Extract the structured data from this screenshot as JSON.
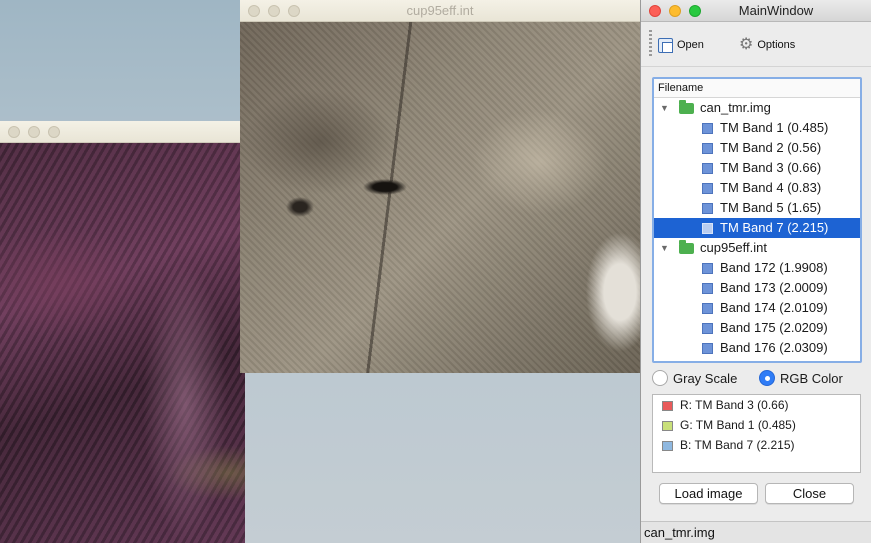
{
  "windows": {
    "left_image": {
      "title": ""
    },
    "mid_image": {
      "title": "cup95eff.int"
    },
    "main": {
      "title": "MainWindow",
      "toolbar": {
        "open_label": "Open",
        "options_label": "Options"
      },
      "tree": {
        "header": "Filename",
        "files": [
          {
            "name": "can_tmr.img",
            "bands": [
              "TM Band 1 (0.485)",
              "TM Band 2 (0.56)",
              "TM Band 3 (0.66)",
              "TM Band 4 (0.83)",
              "TM Band 5 (1.65)",
              "TM Band 7 (2.215)"
            ]
          },
          {
            "name": "cup95eff.int",
            "bands": [
              "Band 172 (1.9908)",
              "Band 173 (2.0009)",
              "Band 174 (2.0109)",
              "Band 175 (2.0209)",
              "Band 176 (2.0309)"
            ]
          }
        ],
        "selected": "TM Band 7 (2.215)"
      },
      "mode": {
        "gray_label": "Gray Scale",
        "rgb_label": "RGB Color",
        "selected": "RGB Color"
      },
      "channels": [
        {
          "label": "R: TM Band 3 (0.66)",
          "color": "#e85a5a"
        },
        {
          "label": "G: TM Band 1 (0.485)",
          "color": "#c9e07a"
        },
        {
          "label": "B: TM Band 7 (2.215)",
          "color": "#8fb8e0"
        }
      ],
      "buttons": {
        "load_label": "Load image",
        "close_label": "Close"
      },
      "status": "can_tmr.img"
    }
  }
}
